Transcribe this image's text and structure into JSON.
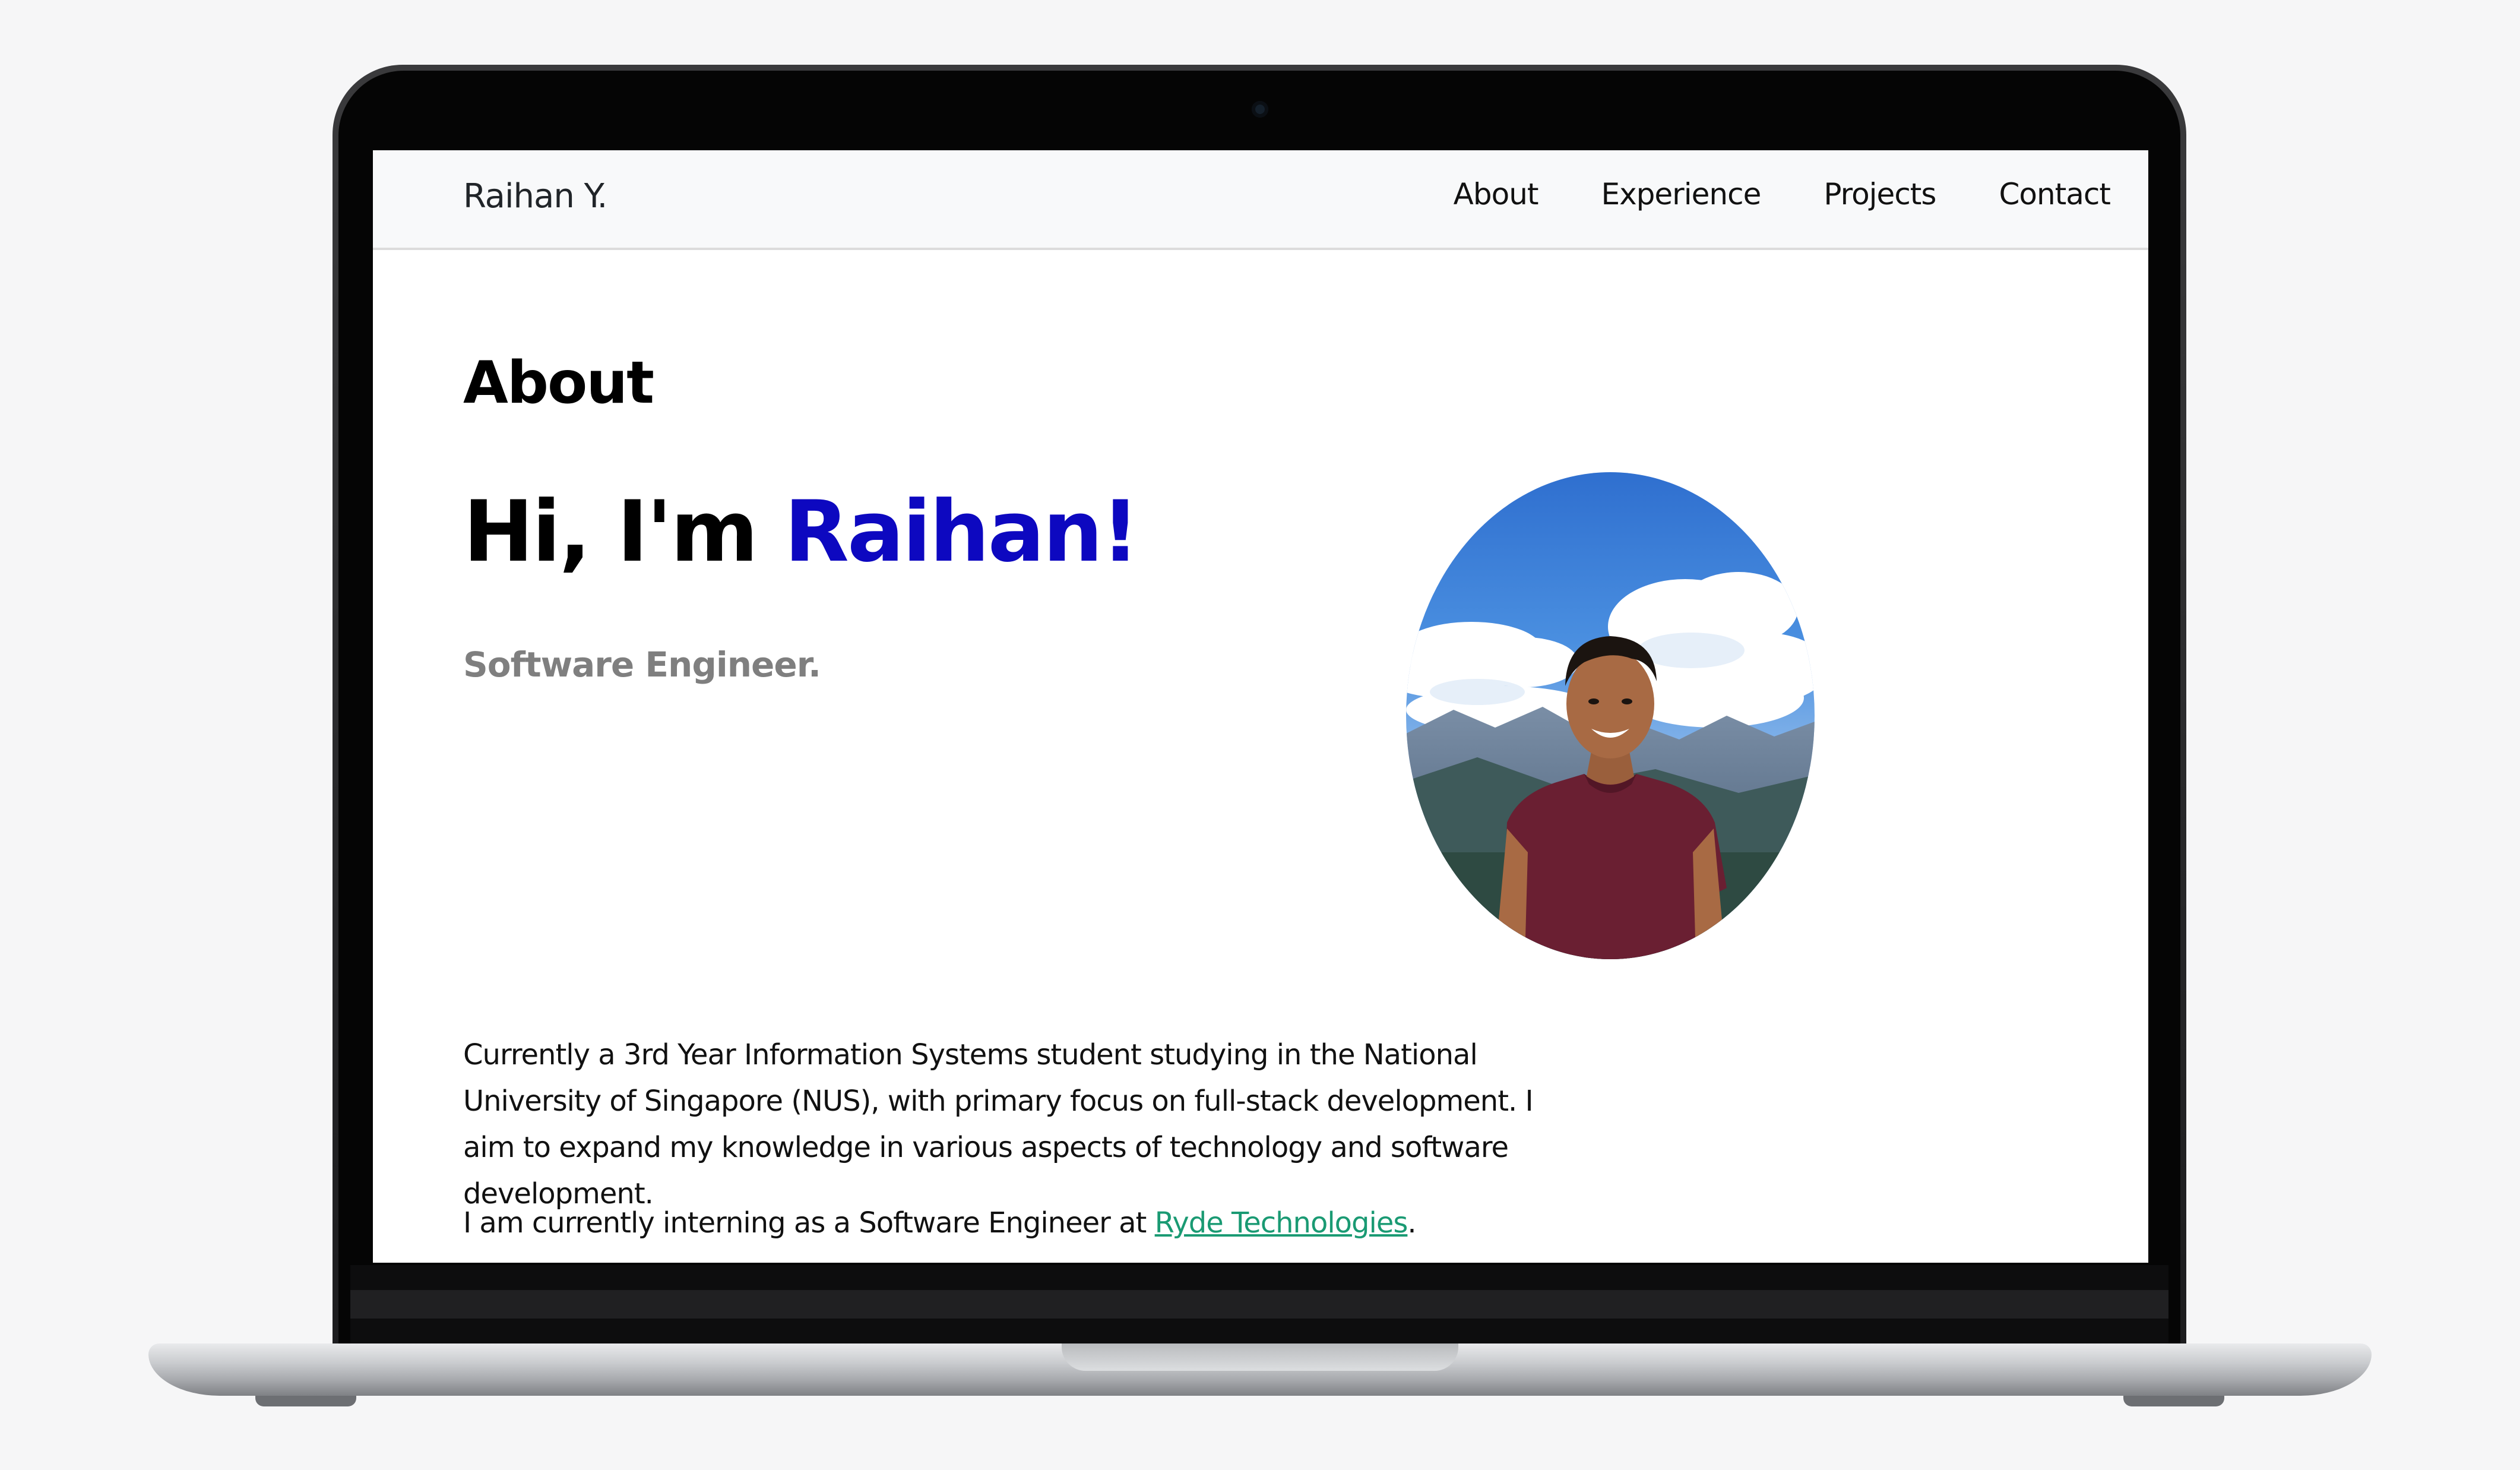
{
  "nav": {
    "brand": "Raihan Y.",
    "links": [
      "About",
      "Experience",
      "Projects",
      "Contact"
    ]
  },
  "about": {
    "section_title": "About",
    "greeting_prefix": "Hi, I'm ",
    "greeting_name": "Raihan!",
    "role": "Software Engineer.",
    "bio": "Currently a 3rd Year Information Systems student studying in the National University of Singapore (NUS), with primary focus on full-stack development. I aim to expand my knowledge in various aspects of technology and software development.",
    "intern_prefix": "I am currently interning as a Software Engineer at ",
    "intern_company": "Ryde Technologies",
    "intern_suffix": "."
  },
  "colors": {
    "accent_name": "#0d08c0",
    "link": "#1a9a73",
    "role": "#7f7f7f"
  },
  "icons": [
    "camera-icon"
  ]
}
